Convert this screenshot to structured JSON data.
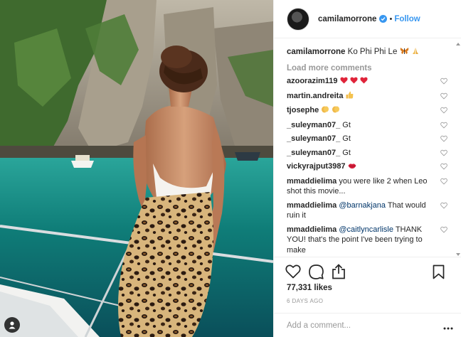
{
  "header": {
    "username": "camilamorrone",
    "separator": "•",
    "follow_label": "Follow"
  },
  "caption": {
    "username": "camilamorrone",
    "text": "Ko Phi Phi Le",
    "emoji": [
      "butterfly",
      "praying-hands"
    ]
  },
  "load_more_label": "Load more comments",
  "comments": [
    {
      "username": "azoorazim119",
      "text": "",
      "emoji": [
        "heart",
        "heart",
        "heart"
      ]
    },
    {
      "username": "martin.andreita",
      "text": "",
      "emoji": [
        "thumbs-up"
      ]
    },
    {
      "username": "tjosephe",
      "text": "",
      "emoji": [
        "clapping",
        "clapping"
      ]
    },
    {
      "username": "_suleyman07_",
      "text": "Gt",
      "emoji": []
    },
    {
      "username": "_suleyman07_",
      "text": "Gt",
      "emoji": []
    },
    {
      "username": "_suleyman07_",
      "text": "Gt",
      "emoji": []
    },
    {
      "username": "vickyrajput3987",
      "text": "",
      "emoji": [
        "kiss"
      ]
    },
    {
      "username": "mmaddielima",
      "text": "you were like 2 when Leo shot this movie...",
      "emoji": []
    },
    {
      "username": "mmaddielima",
      "mention": "@barnakjana",
      "text": "That would ruin it",
      "emoji": []
    },
    {
      "username": "mmaddielima",
      "mention": "@caitlyncarlisle",
      "text": "THANK YOU! that's the point I've been trying to make",
      "emoji": []
    }
  ],
  "likes_text": "77,331 likes",
  "date_text": "6 DAYS AGO",
  "add_comment": {
    "placeholder": "Add a comment..."
  },
  "icons": {
    "like": "heart-outline-icon",
    "comment": "comment-icon",
    "share": "share-icon",
    "save": "bookmark-icon",
    "options": "more-options-icon"
  },
  "colors": {
    "link": "#3897f0",
    "muted": "#999999",
    "text": "#262626",
    "heart": "#ed4956"
  }
}
